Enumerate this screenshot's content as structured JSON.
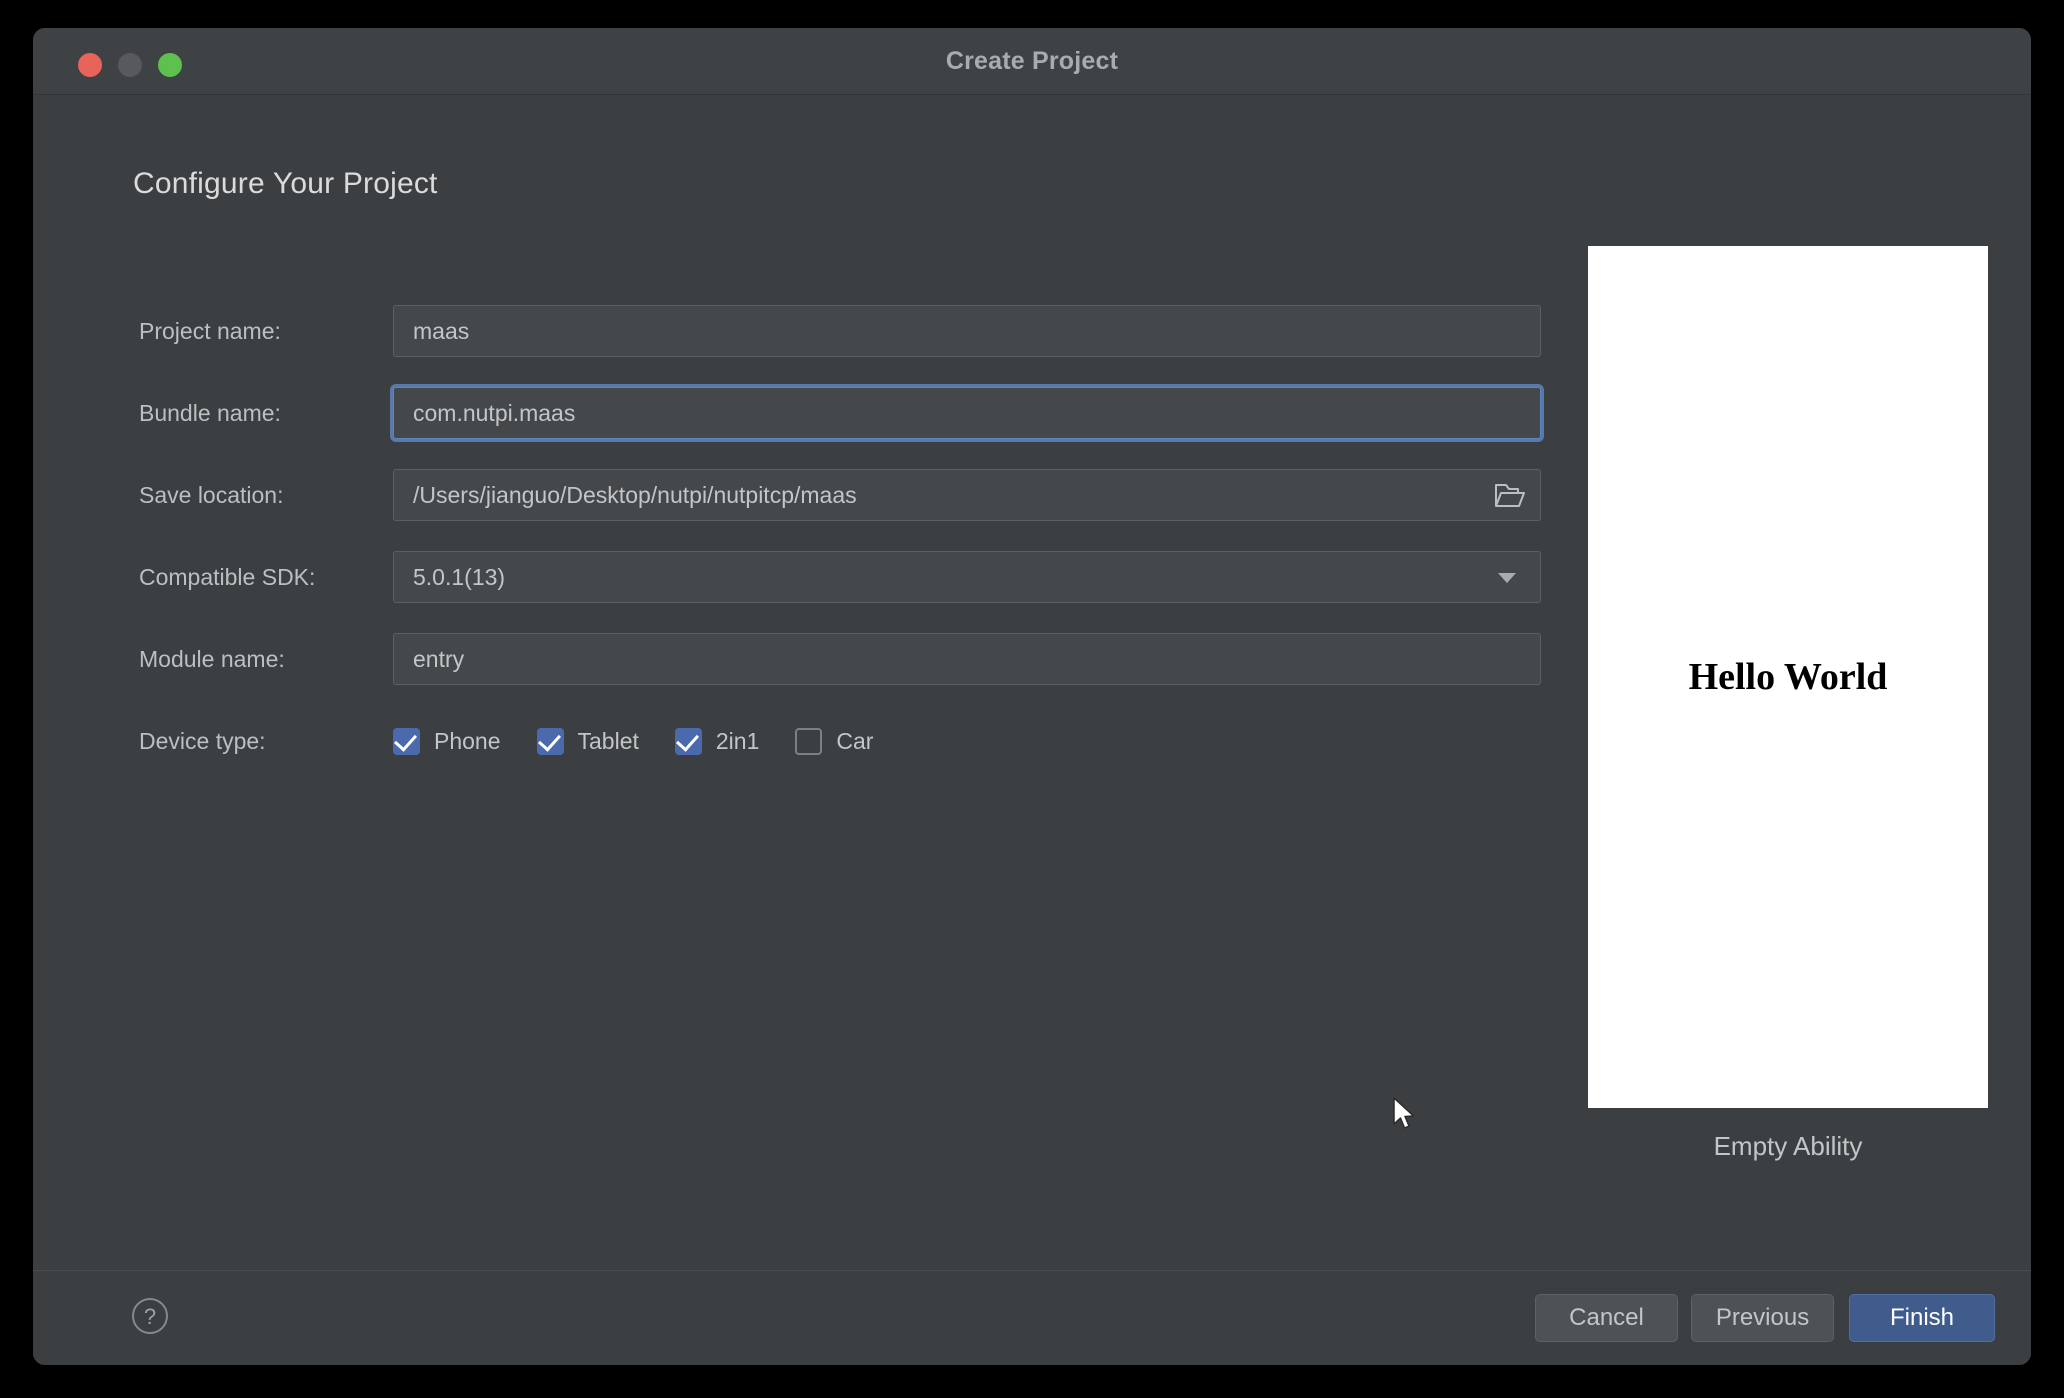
{
  "window": {
    "title": "Create Project",
    "traffic_lights": [
      "close-button",
      "minimize-button",
      "maximize-button"
    ]
  },
  "page": {
    "heading": "Configure Your Project"
  },
  "form": {
    "rows": [
      {
        "label": "Project name:",
        "value": "maas",
        "type": "text",
        "focused": false
      },
      {
        "label": "Bundle name:",
        "value": "com.nutpi.maas",
        "type": "text",
        "focused": true
      },
      {
        "label": "Save location:",
        "value": "/Users/jianguo/Desktop/nutpi/nutpitcp/maas",
        "type": "path",
        "focused": false,
        "icon": "open-folder-icon"
      },
      {
        "label": "Compatible SDK:",
        "value": "5.0.1(13)",
        "type": "dropdown",
        "focused": false,
        "icon": "chevron-down-icon"
      },
      {
        "label": "Module name:",
        "value": "entry",
        "type": "text",
        "focused": false
      }
    ],
    "device_type": {
      "label": "Device type:",
      "options": [
        {
          "label": "Phone",
          "checked": true
        },
        {
          "label": "Tablet",
          "checked": true
        },
        {
          "label": "2in1",
          "checked": true
        },
        {
          "label": "Car",
          "checked": false
        }
      ]
    }
  },
  "preview": {
    "screen_text": "Hello World",
    "caption": "Empty Ability"
  },
  "footer": {
    "help_label": "?",
    "buttons": [
      {
        "label": "Cancel",
        "style": "secondary"
      },
      {
        "label": "Previous",
        "style": "secondary"
      },
      {
        "label": "Finish",
        "style": "primary"
      }
    ]
  },
  "colors": {
    "window_bg": "#3c3f41",
    "titlebar_bg": "#3f4244",
    "field_bg": "#45484a",
    "accent_blue": "#4a6aad",
    "primary_button": "#3f5c8c",
    "focus_ring": "#5d84bd",
    "close_red": "#e8635a",
    "minimize_gray": "#57595c",
    "maximize_green": "#5ec04f"
  }
}
